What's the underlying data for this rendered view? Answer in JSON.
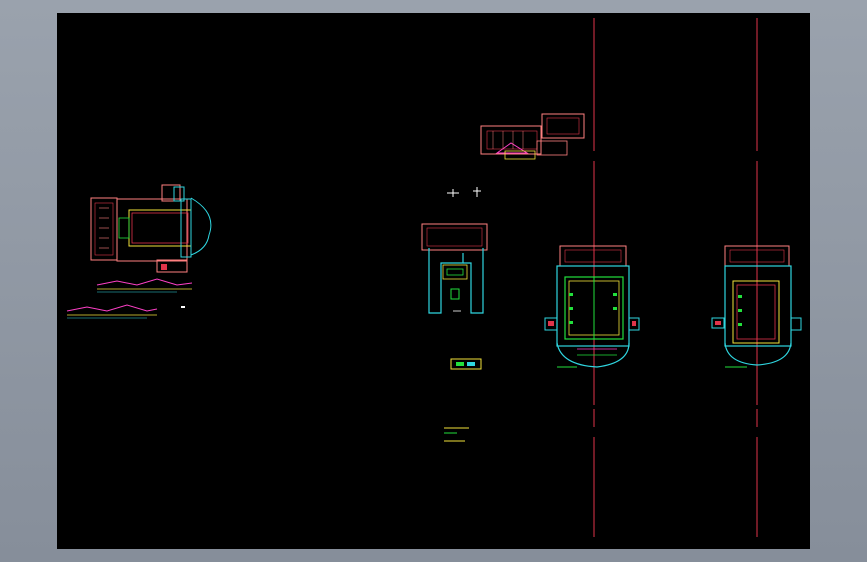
{
  "viewer": {
    "background_color": "#8f97a3",
    "canvas_color": "#000000"
  },
  "colors": {
    "red": "#e0344a",
    "pink": "#ff8080",
    "cyan": "#2fd6e0",
    "green": "#22e03c",
    "yellow": "#f2e23a",
    "white": "#ffffff",
    "magenta": "#ff40c8"
  },
  "drawings": [
    {
      "name": "floor-plan-left",
      "icon": "floor-plan-icon"
    },
    {
      "name": "roof-plan-top",
      "icon": "roof-plan-icon"
    },
    {
      "name": "section-small",
      "icon": "section-icon"
    },
    {
      "name": "floor-plan-center",
      "icon": "floor-plan-icon"
    },
    {
      "name": "floor-plan-right",
      "icon": "floor-plan-icon"
    }
  ]
}
